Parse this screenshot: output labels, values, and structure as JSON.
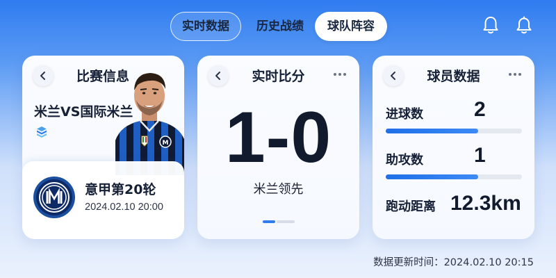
{
  "tabs": [
    {
      "label": "实时数据",
      "active": false,
      "outlined": true
    },
    {
      "label": "历史战绩",
      "active": false
    },
    {
      "label": "球队阵容",
      "active": true
    }
  ],
  "header_icons": [
    "bell-outline-icon",
    "bell-icon"
  ],
  "match_card": {
    "title": "比赛信息",
    "match": "米兰VS国际米兰",
    "round": "意甲第20轮",
    "datetime": "2024.02.10 20:00"
  },
  "score_card": {
    "title": "实时比分",
    "score": "1-0",
    "status": "米兰领先",
    "page_index": 1
  },
  "player_card": {
    "title": "球员数据",
    "stats": [
      {
        "label": "进球数",
        "value": "2",
        "progress": 0.68
      },
      {
        "label": "助攻数",
        "value": "1",
        "progress": 0.68
      },
      {
        "label": "跑动距离",
        "value": "12.3km"
      }
    ]
  },
  "footer": {
    "updated": "数据更新时间：2024.02.10 20:15"
  },
  "colors": {
    "accent": "#2f7cf0",
    "bg_top": "#2f7cf0",
    "bg_bottom": "#eaf1fd",
    "inter_blue": "#1a4fa0"
  }
}
